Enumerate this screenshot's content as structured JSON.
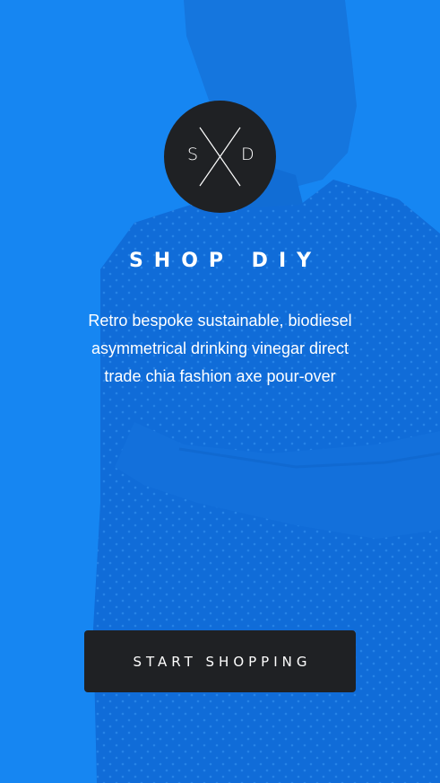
{
  "logo": {
    "left_letter": "S",
    "right_letter": "D"
  },
  "brand": {
    "title": "SHOP DIY"
  },
  "tagline": {
    "lines": [
      "Retro bespoke sustainable, biodiesel",
      "asymmetrical drinking vinegar direct",
      "trade chia fashion axe pour-over"
    ]
  },
  "cta": {
    "label": "START SHOPPING"
  },
  "colors": {
    "overlay": "#1787f2",
    "dark": "#1f2124",
    "text": "#ffffff"
  }
}
